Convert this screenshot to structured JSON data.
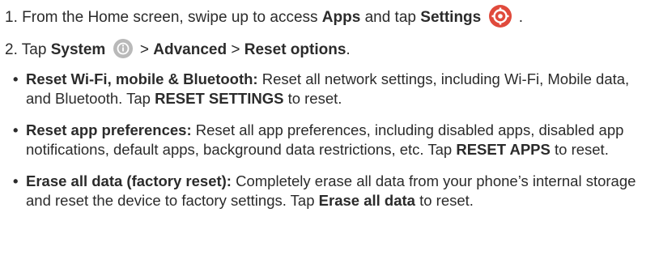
{
  "step1": {
    "number": "1.",
    "text_before": "From the Home screen, swipe up to access",
    "apps": "Apps",
    "and_tap": "and tap",
    "settings": "Settings",
    "end": "."
  },
  "step2": {
    "number": "2.",
    "tap": "Tap",
    "system": "System",
    "sep1": ">",
    "advanced": "Advanced",
    "sep2": ">",
    "reset_options": "Reset options",
    "end": "."
  },
  "bullets": [
    {
      "title": "Reset Wi-Fi, mobile & Bluetooth:",
      "body": "Reset all network settings, including Wi-Fi, Mobile data, and Bluetooth. Tap",
      "action": "RESET SETTINGS",
      "tail": "to reset."
    },
    {
      "title": "Reset app preferences:",
      "body": "Reset all app preferences, including disabled apps, disabled app notifications, default apps, background data restrictions, etc. Tap",
      "action": "RESET APPS",
      "tail": "to reset."
    },
    {
      "title": "Erase all data (factory reset):",
      "body": "Completely erase all data from your phone’s internal storage and reset the device to factory settings. Tap",
      "action": "Erase all data",
      "tail": "to reset."
    }
  ],
  "colors": {
    "text": "#2b2b2b",
    "settings_icon_bg": "#e04a3c",
    "system_icon_bg": "#b9b9b9"
  },
  "icons": {
    "settings": "settings-gear-icon",
    "system": "info-icon"
  }
}
